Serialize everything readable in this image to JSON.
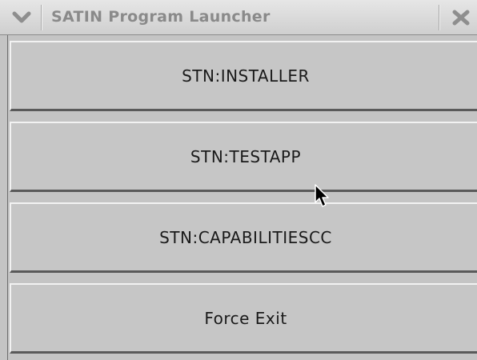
{
  "window": {
    "title": "SATIN Program Launcher"
  },
  "buttons": [
    {
      "label": "STN:INSTALLER"
    },
    {
      "label": "STN:TESTAPP"
    },
    {
      "label": "STN:CAPABILITIESCC"
    },
    {
      "label": "Force Exit"
    }
  ],
  "icons": {
    "window_menu": "chevron-down-icon",
    "window_close": "close-icon",
    "pointer": "mouse-cursor-icon"
  },
  "colors": {
    "background": "#c4c4c4",
    "title_text": "#8a8a8a",
    "button_text": "#1a1a1a"
  }
}
